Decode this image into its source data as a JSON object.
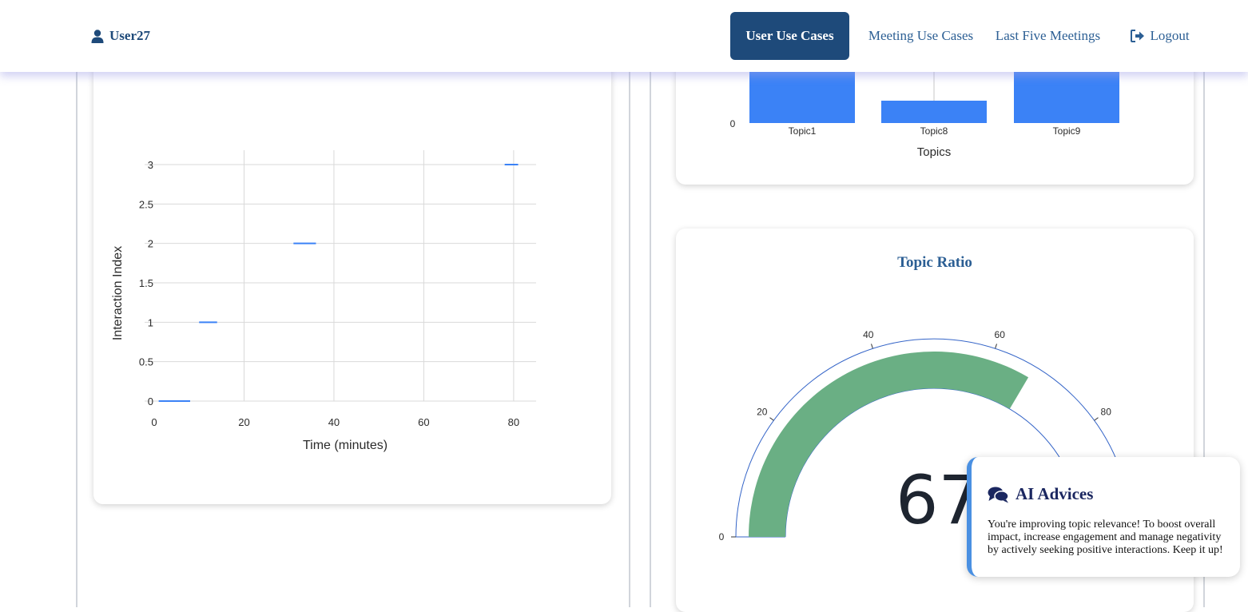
{
  "user": {
    "name": "User27",
    "icon": "user-icon"
  },
  "nav": {
    "user_use_cases": "User Use Cases",
    "meeting_use_cases": "Meeting Use Cases",
    "last_five_meetings": "Last Five Meetings",
    "logout": "Logout",
    "logout_icon": "logout-icon"
  },
  "colors": {
    "nav_active": "#1e4a7a",
    "nav_link": "#2c5f94",
    "bar": "#3b82f6",
    "gauge": "#6aaf84",
    "title": "#2c5f94"
  },
  "interaction_chart": {
    "chart_data": {
      "type": "scatter",
      "xlabel": "Time (minutes)",
      "ylabel": "Interaction Index",
      "xlim": [
        0,
        85
      ],
      "ylim": [
        0,
        3
      ],
      "xticks": [
        "0",
        "20",
        "40",
        "60",
        "80"
      ],
      "yticks": [
        "0",
        "0.5",
        "1",
        "1.5",
        "2",
        "2.5",
        "3"
      ],
      "segments": [
        {
          "y": 0,
          "x_start": 1,
          "x_end": 8
        },
        {
          "y": 1,
          "x_start": 10,
          "x_end": 14
        },
        {
          "y": 2,
          "x_start": 31,
          "x_end": 36
        },
        {
          "y": 3,
          "x_start": 78,
          "x_end": 81
        }
      ],
      "grid": true
    }
  },
  "topics_chart": {
    "chart_data": {
      "type": "bar",
      "xlabel": "Topics",
      "categories": [
        "Topic1",
        "Topic8",
        "Topic9"
      ],
      "values": [
        10,
        1,
        10
      ],
      "ytick_visible": "0"
    }
  },
  "topic_ratio": {
    "title": "Topic Ratio",
    "value": "67",
    "chart_data": {
      "type": "gauge",
      "value": 67,
      "range": [
        0,
        100
      ],
      "ticks": [
        "0",
        "20",
        "40",
        "60",
        "80"
      ]
    }
  },
  "ai_advice": {
    "title": "AI Advices",
    "icon": "comments-icon",
    "text": "You're improving topic relevance! To boost overall impact, increase engagement and manage negativity by actively seeking positive interactions. Keep it up!"
  }
}
